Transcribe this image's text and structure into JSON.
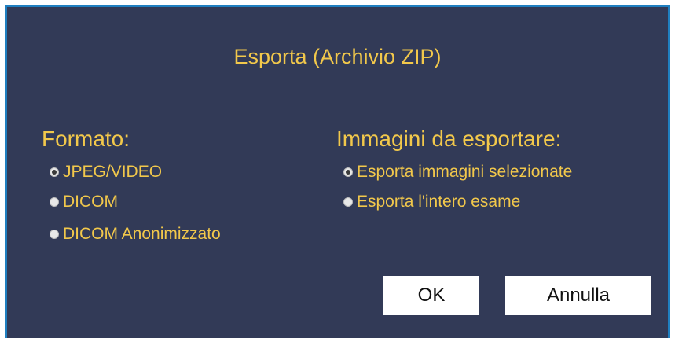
{
  "dialog": {
    "title": "Esporta (Archivio ZIP)",
    "accent_border_color": "#1f7fc0",
    "background_color": "#323a57",
    "text_color": "#f2c84b"
  },
  "format": {
    "heading": "Formato:",
    "options": [
      {
        "label": "JPEG/VIDEO",
        "checked": true
      },
      {
        "label": "DICOM",
        "checked": false
      },
      {
        "label": "DICOM Anonimizzato",
        "checked": false
      }
    ]
  },
  "images": {
    "heading": "Immagini da esportare:",
    "options": [
      {
        "label": "Esporta immagini selezionate",
        "checked": true
      },
      {
        "label": "Esporta l'intero esame",
        "checked": false
      }
    ]
  },
  "buttons": {
    "ok_label": "OK",
    "cancel_label": "Annulla"
  }
}
